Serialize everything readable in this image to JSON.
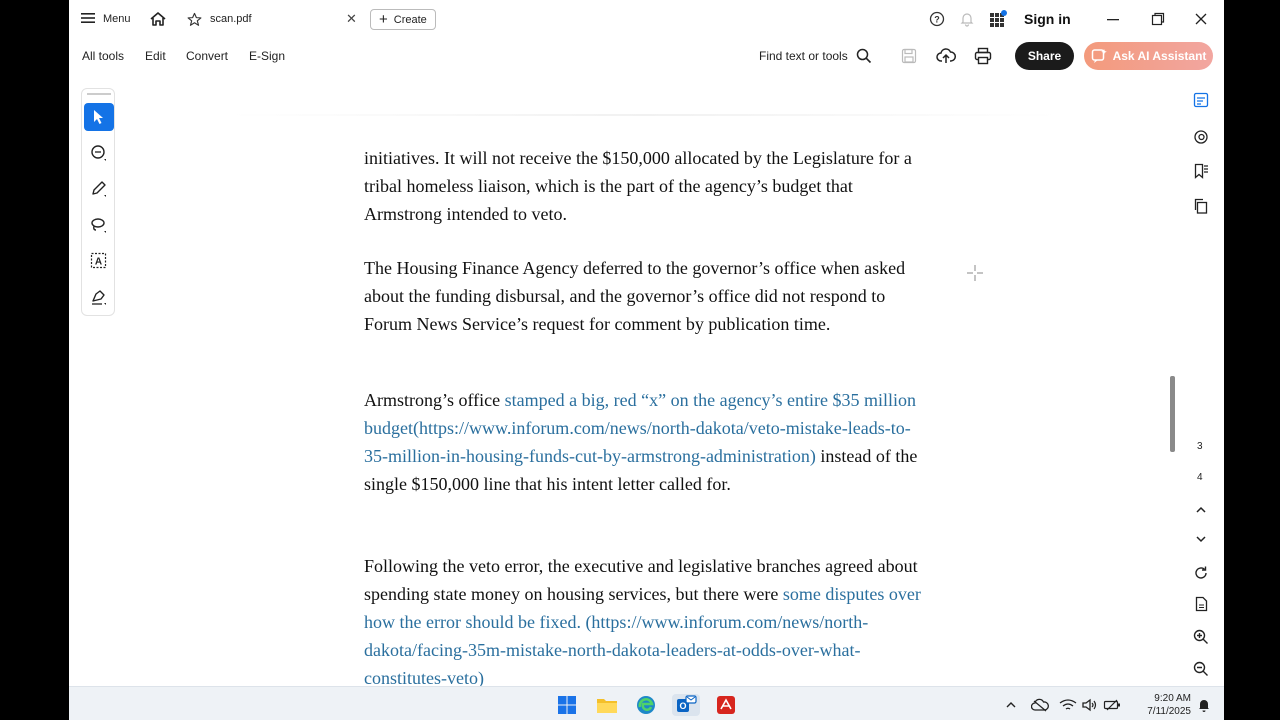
{
  "titlebar": {
    "menu_label": "Menu",
    "tab_title": "scan.pdf",
    "create_label": "Create",
    "signin_label": "Sign in"
  },
  "toolbar": {
    "menus": [
      "All tools",
      "Edit",
      "Convert",
      "E-Sign"
    ],
    "find_placeholder": "Find text or tools",
    "share_label": "Share",
    "ai_label": "Ask AI Assistant"
  },
  "left_tools": [
    "select-tool",
    "comment-tool",
    "highlight-tool",
    "draw-tool",
    "text-select-tool",
    "sign-tool"
  ],
  "document": {
    "p1": "initiatives. It will not receive the $150,000 allocated by the Legislature for a tribal homeless liaison, which is the part of the agency’s budget that Armstrong intended to veto.",
    "p2": "The Housing Finance Agency deferred to the governor’s office when asked about the funding disbursal, and the governor’s office did not respond to Forum News Service’s request for comment by publication time.",
    "p3_before": "Armstrong’s office ",
    "p3_link": "stamped a big, red “x” on the agency’s entire $35 million budget(https://www.inforum.com/news/north-dakota/veto-mistake-leads-to-35-million-in-housing-funds-cut-by-armstrong-administration)",
    "p3_after": " instead of the single $150,000 line that his intent letter called for.",
    "p4_before": "Following the veto error, the executive and legislative branches agreed about spending state money on housing services, but there were ",
    "p4_link": "some disputes over how the error should be fixed. (https://www.inforum.com/news/north-dakota/facing-35m-mistake-north-dakota-leaders-at-odds-over-what-constitutes-veto)"
  },
  "right_rail": {
    "page_numbers": [
      "3",
      "4"
    ]
  },
  "taskbar": {
    "time": "9:20 AM",
    "date": "7/11/2025"
  },
  "colors": {
    "accent": "#1473e6",
    "link": "#2a6f9e",
    "share_bg": "#1b1b1b",
    "ai_gradient_start": "#f39a7c"
  }
}
